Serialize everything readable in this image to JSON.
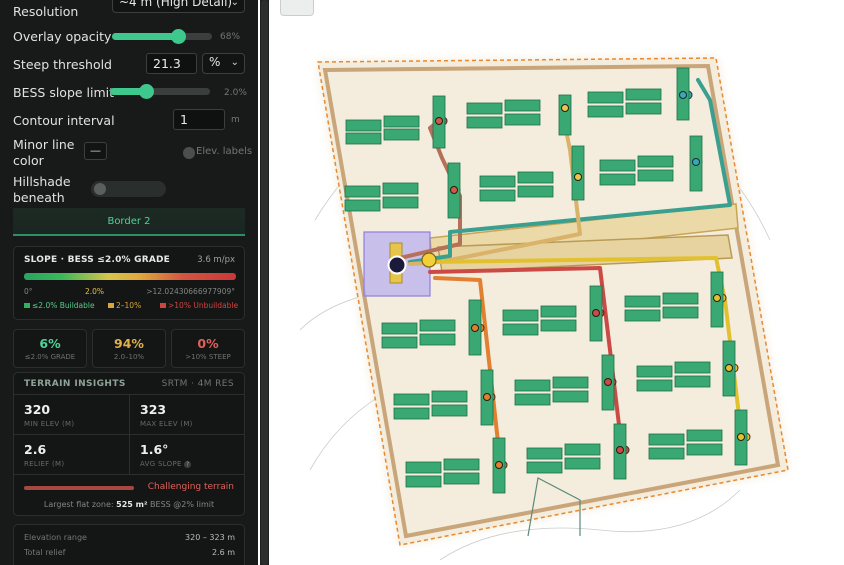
{
  "controls": {
    "resolution_label": "Resolution",
    "resolution_value": "~4 m (High Detail)",
    "overlay_opacity_label": "Overlay opacity",
    "overlay_opacity_value": "68%",
    "overlay_opacity_level": 0.68,
    "steep_threshold_label": "Steep threshold",
    "steep_threshold_value": "21.3",
    "steep_threshold_unit": "%",
    "bess_slope_label": "BESS slope limit",
    "bess_slope_value": "2.0%",
    "bess_slope_level": 0.35,
    "contour_interval_label": "Contour interval",
    "contour_interval_value": "1",
    "contour_interval_unit": "m",
    "minor_line_label_1": "Minor line",
    "minor_line_label_2": "color",
    "minor_line_swatch": "—",
    "elev_labels_label": "Elev. labels",
    "hillshade_label_1": "Hillshade",
    "hillshade_label_2": "beneath"
  },
  "border_tab": "Border 2",
  "slope_card": {
    "title": "SLOPE · BESS ≤2.0% GRADE",
    "resolution": "3.6 m/px",
    "tick_min": "0°",
    "tick_mid": "2.0%",
    "tick_max": ">12.02430666977909°",
    "legend_buildable": "≤2.0% Buildable",
    "legend_mid": "2–10%",
    "legend_unbuildable": ">10% Unbuildable",
    "color_buildable": "#2fb062",
    "color_mid": "#d9a53a",
    "color_unbuildable": "#d0443e"
  },
  "stats": [
    {
      "value": "6%",
      "label": "≤2.0% GRADE",
      "color": "#4fd39a"
    },
    {
      "value": "94%",
      "label": "2.0–10%",
      "color": "#e2b04a"
    },
    {
      "value": "0%",
      "label": ">10% STEEP",
      "color": "#e0605a"
    }
  ],
  "terrain": {
    "title": "TERRAIN INSIGHTS",
    "source": "SRTM · 4M RES",
    "min_elev": "320",
    "min_elev_label": "MIN ELEV (M)",
    "max_elev": "323",
    "max_elev_label": "MAX ELEV (M)",
    "relief": "2.6",
    "relief_label": "RELIEF (M)",
    "avg_slope": "1.6°",
    "avg_slope_label": "AVG SLOPE",
    "challenge_text": "Challenging terrain",
    "challenge_level": 0.5,
    "flat_zone_prefix": "Largest flat zone:",
    "flat_zone_value": "525 m²",
    "flat_zone_suffix": "BESS @2% limit"
  },
  "summary": {
    "elev_range_label": "Elevation range",
    "elev_range_value": "320 – 323 m",
    "total_relief_label": "Total relief",
    "total_relief_value": "2.6 m"
  }
}
